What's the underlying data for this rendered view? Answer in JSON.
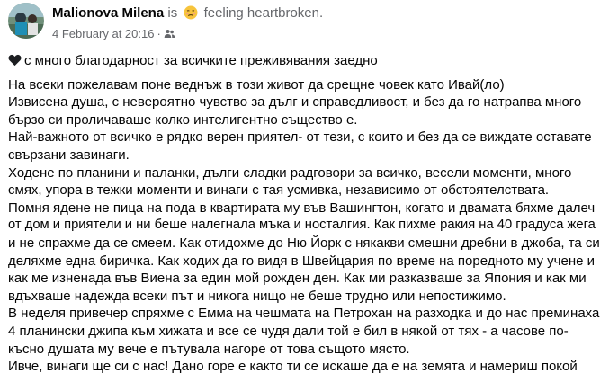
{
  "post": {
    "author": "Malionova Milena",
    "status_prefix": "is",
    "feeling_text": "feeling heartbroken.",
    "feeling_icon": "sad-face-icon",
    "date": "4 February at 20:16",
    "separator": "·",
    "audience_icon": "friends-audience-icon",
    "intro_icon": "black-heart-icon",
    "intro_text": "с много благодарност за всичките преживявания заедно",
    "lines": [
      "На всеки пожелавам поне веднъж в този живот да срещне човек като Ивай(ло)",
      "Извисена душа, с невероятно чувство за дълг и справедливост, и без да го натрапва много",
      "бързо си проличаваше колко интелигентно същество е.",
      "Най-важното от всичко е рядко верен приятел- от тези, с които и без да се виждате оставате",
      "свързани завинаги.",
      "Ходене по планини и паланки, дълги сладки радговори за всичко, весели моменти, много",
      "смях, упора в тежки моменти и винаги с тая усмивка, независимо от обстоятелствата.",
      "Помня ядене не пица на пода в квартирата му във Вашингтон, когато и двамата бяхме далеч",
      "от дом и приятели и ни беше налегнала мъка и носталгия. Как пихме ракия на 40 градуса жега",
      "и не спрахме да се смеем. Как отидохме до Ню Йорк с някакви смешни дребни в джоба, та си",
      "деляхме една биричка. Как ходих да го видя в Швейцария по време на поредното му учене и",
      "как ме изненада във Виена за един мой рожден ден. Как ми разказваше за Япония и как ми",
      "вдъхваше надежда всеки път и никога нищо не беше трудно или непостижимо.",
      "В неделя привечер спряхме с Емма на чешмата на Петрохан на разходка и до нас преминаха",
      "4 планински джипа към хижата и все се чудя дали той е бил в някой от тях - а часове по-",
      "късно душата му вече е пътувала нагоре от това същото място.",
      "Ивче, винаги ще си с нас! Дано горе е както ти се искаше да е на земята и намериш покой"
    ]
  },
  "colors": {
    "text": "#050505",
    "secondary_text": "#65676b",
    "background": "#ffffff",
    "emoji_face": "#f7c43c"
  }
}
